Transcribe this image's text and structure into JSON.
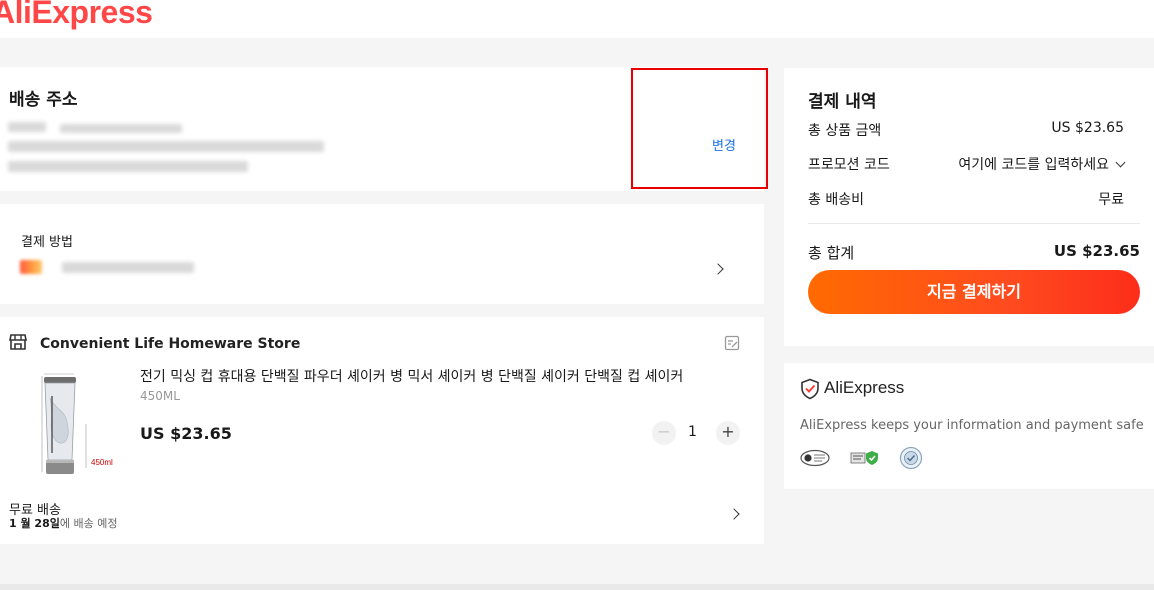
{
  "header": {
    "logo_text": "AliExpress"
  },
  "address": {
    "title": "배송 주소",
    "change_label": "변경"
  },
  "payment": {
    "title": "결제 방법"
  },
  "store": {
    "name": "Convenient Life Homeware Store",
    "product": {
      "title": "전기 믹싱 컵 휴대용 단백질 파우더 셰이커 병 믹서 셰이커 병 단백질 셰이커 단백질 컵 셰이커",
      "variant": "450ML",
      "price": "US $23.65",
      "quantity": "1",
      "image_caption": "450ml"
    },
    "shipping": {
      "label": "무료 배송",
      "date": "1 월 28일",
      "date_suffix": "에 배송 예정"
    }
  },
  "summary": {
    "title": "결제 내역",
    "rows": [
      {
        "label": "총 상품 금액",
        "value": "US $23.65"
      },
      {
        "label": "프로모션 코드",
        "value": "여기에 코드를 입력하세요"
      },
      {
        "label": "총 배송비",
        "value": "무료"
      }
    ],
    "total_label": "총 합계",
    "total_value": "US $23.65",
    "pay_button": "지금 결제하기"
  },
  "security": {
    "brand": "AliExpress",
    "message": "AliExpress keeps your information and payment safe"
  },
  "colors": {
    "brand_red": "#ff4747",
    "pay_gradient_start": "#ff6a00",
    "pay_gradient_end": "#fd2d1a",
    "link_blue": "#1a73e8",
    "highlight_border": "#e60000"
  }
}
